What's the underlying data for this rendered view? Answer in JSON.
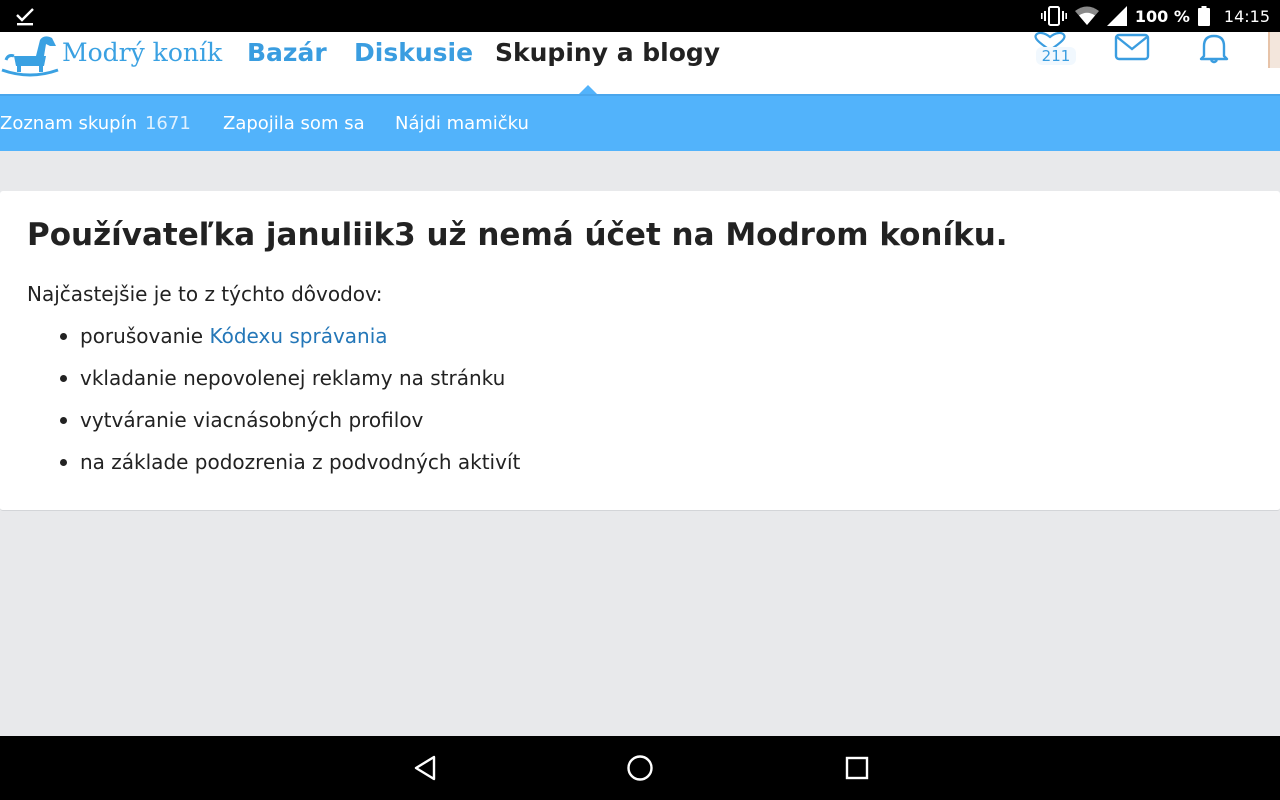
{
  "statusbar": {
    "battery": "100 %",
    "time": "14:15",
    "icons": [
      "download-done-icon",
      "vibrate-icon",
      "wifi-icon",
      "signal-icon",
      "battery-icon"
    ]
  },
  "header": {
    "brand": "Modrý koník",
    "nav": [
      {
        "label": "Bazár",
        "active": false
      },
      {
        "label": "Diskusie",
        "active": false
      },
      {
        "label": "Skupiny a blogy",
        "active": true
      }
    ],
    "heart_count": "211",
    "icons": [
      "heart-icon",
      "mail-icon",
      "bell-icon",
      "avatar"
    ]
  },
  "subnav": {
    "items": [
      {
        "label": "Zoznam skupín",
        "count": "1671"
      },
      {
        "label": "Zapojila som sa"
      },
      {
        "label": "Nájdi mamičku"
      }
    ]
  },
  "main": {
    "title": "Používateľka januliik3 už nemá účet na Modrom koníku.",
    "intro": "Najčastejšie je to z týchto dôvodov:",
    "reasons": [
      {
        "prefix": "porušovanie ",
        "link": "Kódexu správania"
      },
      {
        "text": "vkladanie nepovolenej reklamy na stránku"
      },
      {
        "text": "vytváranie viacnásobných profilov"
      },
      {
        "text": "na základe podozrenia z podvodných aktivít"
      }
    ]
  },
  "colors": {
    "accent": "#3a9de0",
    "subnav_bg": "#52b3fb",
    "link": "#2477b8",
    "page_bg": "#e8e9eb"
  }
}
